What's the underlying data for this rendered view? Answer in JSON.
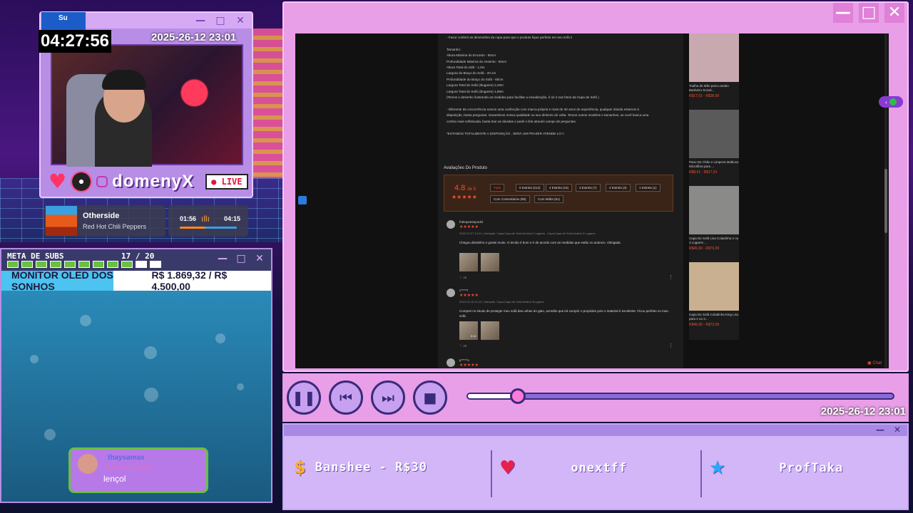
{
  "webcam": {
    "sub_tag": "Su",
    "timer": "04:27:56",
    "date": "2025-26-12 23:01",
    "handle": "domenyX",
    "live_label": "● LIVE"
  },
  "music": {
    "title": "Otherside",
    "artist": "Red Hot Chili Peppers",
    "elapsed": "01:56",
    "duration": "04:15",
    "progress": 0.45
  },
  "goal": {
    "label": "META DE SUBS",
    "count": "17 / 20",
    "filled": 17,
    "total": 20,
    "monitor_name": "MONITOR OLED DOS SONHOS",
    "monitor_value": "R$ 1.869,32 / R$ 4.500,00",
    "monitor_progress": 0.415
  },
  "chat": {
    "user": "thaysamax",
    "meta": "3 Meses Inscrito",
    "message": "lençol"
  },
  "product_page": {
    "description_lines": [
      "- Favor conferir as dimensões da capa para que o produto fique perfeito em seu sofá !!",
      "",
      "Tamanho:",
      "Altura Máxima do Encosto - 60cm",
      "Profundidade Máxima do Assento - 60cm",
      "Altura Total do sofá - 1,0m",
      "Largura do Braço do Sofá - 20 cm",
      "Profundidade do Braço do Sofá - 80cm",
      "Largura Total do Sofá (3lugares) 2,20m",
      "Largura Total do Sofá (2lugares) 1,80m",
      "(Temos o desenho ilustrando as medidas para facilitar a visualização, é só ir nas fotos da Capa de Sofá )",
      "",
      "- Diferente da concorrência somos uma confecção com marca própria e mais de 30 anos de experiência, qualquer dúvida estamos à",
      "disposição, basta perguntar. Garantimos nossa qualidade ou seu dinheiro de volta. Temos outros modelos e tamanhos, se você busca uma",
      "cortina mais sofisticada, basta tirar as dúvidas e pedir o link através campo de perguntas.",
      "",
      "*ESTAMOS TOTALMENTE A DISPOSIÇÃO , SERÁ UM PRAZER ATENDE-LO !!"
    ],
    "reviews_title": "Avaliações Do Produto",
    "score": "4.8",
    "score_suffix": "de 5",
    "stars": "★★★★★",
    "filters_row1": [
      "Tudo",
      "5 Estrela (212)",
      "4 Estrela (16)",
      "3 Estrela (7)",
      "2 Estrela (3)",
      "1 Estrela (1)"
    ],
    "filters_row2": [
      "Com Comentários (95)",
      "Com Mídia (51)"
    ],
    "reviews": [
      {
        "name": "fraleqsantopodol",
        "stars": "★★★★★",
        "date": "2023-07-07 14:01 | Variação: Capa,Capa de Sofá Andina 3 Lugares , Capa,Capa de Sofá Andina 3 Lugares",
        "text": "Chegou direitinho e gostei muito. O tecido é bom e é de acordo com as medidas que estão no anúncio. Obrigada.",
        "likes": "♡ 46"
      },
      {
        "name": "c*****r",
        "stars": "★★★★★",
        "date": "2024-02-15 11:22 | Variação: Capa,Capa de Sofá Andina 3Lugares",
        "text": "Comprei no intuito de proteger meu sofá das unhas do gato, acredito que irá cumprir o propósito pois o material é excelente. Ficou perfeito no meu sofá.",
        "likes": "♡ 29",
        "video_time": "0:12"
      },
      {
        "name": "p*****o",
        "stars": "★★★★★"
      }
    ],
    "sidebar_products": [
      {
        "name": "Toalha de Mão para Lavabo Banheiro Social...",
        "price": "R$17,01 - R$28,90",
        "color": "#c9a9b0"
      },
      {
        "name": "Pano De Chão e Limpeza Multiuso Microfibra para ...",
        "price": "R$8,91 - R$17,91",
        "color": "#5a5a5a"
      },
      {
        "name": "Capa De Sofá Lisa Coladinha 2 ou 3 Lugares ...",
        "price": "R$49,90 - R$79,90",
        "color": "#8a8a88"
      },
      {
        "name": "Capa De Sofá Coladinha King Liso para 2 ou 3...",
        "price": "R$49,90 - R$73,90",
        "color": "#c8b090"
      }
    ],
    "chat_label": "Chat"
  },
  "player": {
    "pause_icon": "❚❚",
    "prev_icon": "⏮",
    "next_icon": "⏭",
    "stop_icon": "■",
    "progress": 0.12,
    "date": "2025-26-12 23:01"
  },
  "alerts": {
    "donation": "Banshee - R$30",
    "follower": "onextff",
    "subscriber": "ProfTaka"
  },
  "window_controls": {
    "minimize": "—",
    "maximize": "□",
    "close": "✕"
  },
  "colors": {
    "accent": "#e99ee8",
    "brand_orange": "#f04e30",
    "goal_green": "#6ac040"
  }
}
